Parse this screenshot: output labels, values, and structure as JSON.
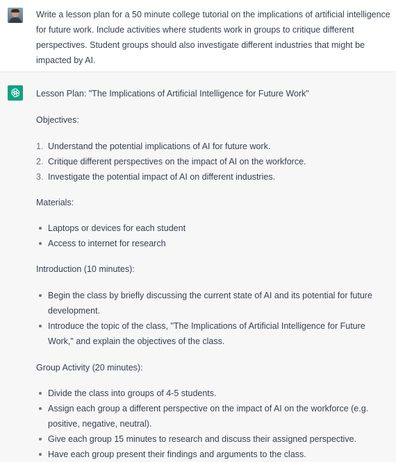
{
  "user_message": "Write a lesson plan for a 50 minute college tutorial on the implications of artificial intelligence for future work. Include activities where students work in groups to critique different perspectives. Student groups should also investigate different industries that might be impacted by AI.",
  "assistant": {
    "title": "Lesson Plan: \"The Implications of Artificial Intelligence for Future Work\"",
    "objectives_heading": "Objectives:",
    "objectives": [
      {
        "num": "1.",
        "text": "Understand the potential implications of AI for future work."
      },
      {
        "num": "2.",
        "text": "Critique different perspectives on the impact of AI on the workforce."
      },
      {
        "num": "3.",
        "text": "Investigate the potential impact of AI on different industries."
      }
    ],
    "materials_heading": "Materials:",
    "materials": [
      "Laptops or devices for each student",
      "Access to internet for research"
    ],
    "intro_heading": "Introduction (10 minutes):",
    "intro": [
      {
        "l1": "Begin the class by briefly discussing the current state of AI and its potential for future",
        "l2": "development."
      },
      {
        "l1": "Introduce the topic of the class, \"The Implications of Artificial Intelligence for Future",
        "l2": "Work,\" and explain the objectives of the class."
      }
    ],
    "group_heading": "Group Activity (20 minutes):",
    "group": [
      {
        "l1": "Divide the class into groups of 4-5 students."
      },
      {
        "l1": "Assign each group a different perspective on the impact of AI on the workforce (e.g.",
        "l2": "positive, negative, neutral)."
      },
      {
        "l1": "Give each group 15 minutes to research and discuss their assigned perspective."
      },
      {
        "l1": "Have each group present their findings and arguments to the class."
      }
    ]
  },
  "colors": {
    "user_bg": "#ffffff",
    "assistant_bg": "#f7f7f8",
    "logo_green": "#10a37f",
    "text": "#374151"
  },
  "icons": {
    "user_avatar": "user-avatar-photo",
    "assistant_logo": "openai-logo-icon"
  }
}
